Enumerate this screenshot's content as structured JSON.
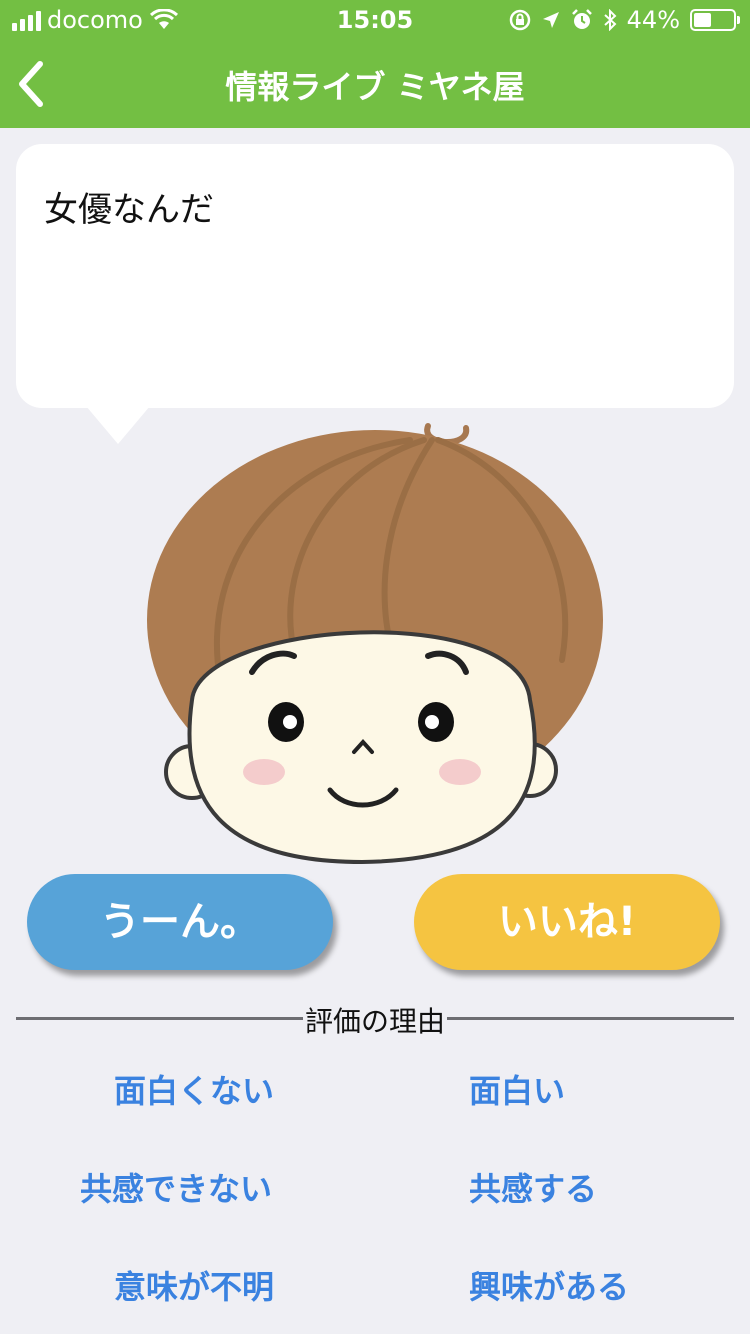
{
  "status_bar": {
    "carrier": "docomo",
    "time": "15:05",
    "battery": "44%",
    "battery_level": 0.44
  },
  "nav": {
    "title": "情報ライブ ミヤネ屋",
    "back_icon": "chevron-left-icon"
  },
  "bubble": {
    "text": "女優なんだ"
  },
  "buttons": {
    "dislike_label": "うーん。",
    "like_label": "いいね!"
  },
  "reasons": {
    "title": "評価の理由",
    "negative": [
      "面白くない",
      "共感できない",
      "意味が不明"
    ],
    "positive": [
      "面白い",
      "共感する",
      "興味がある"
    ]
  },
  "colors": {
    "header": "#73bf43",
    "dislike": "#57a3d8",
    "like": "#f5c441",
    "reason_text": "#3a82e0",
    "background": "#efeff4"
  }
}
